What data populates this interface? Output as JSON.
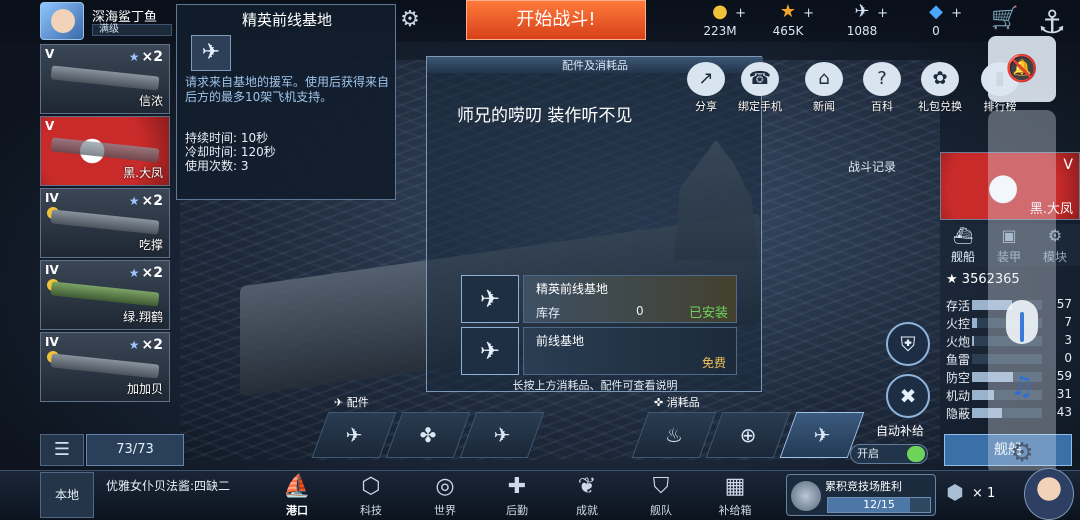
{
  "player": {
    "name": "深海鲨丁鱼",
    "level_label": "满级"
  },
  "header": {
    "start_battle": "开始战斗!"
  },
  "resources": [
    {
      "icon": "gold-coin-icon",
      "value": "223M",
      "color": "#f0c23a"
    },
    {
      "icon": "star-icon",
      "value": "465K",
      "color": "#f3a52b"
    },
    {
      "icon": "plane-icon",
      "value": "1088",
      "color": "#cfe0f0"
    },
    {
      "icon": "diamond-icon",
      "value": "0",
      "color": "#4aa6ff"
    }
  ],
  "ship_list": [
    {
      "tier": "V",
      "mult": "×2",
      "name": "信浓",
      "flag": false
    },
    {
      "tier": "V",
      "mult": "",
      "name": "黑.大凤",
      "flag": true
    },
    {
      "tier": "IV",
      "mult": "×2",
      "name": "吃撑",
      "flag": false
    },
    {
      "tier": "IV",
      "mult": "×2",
      "name": "绿.翔鹤",
      "flag": false
    },
    {
      "tier": "IV",
      "mult": "×2",
      "name": "加加贝",
      "flag": false
    }
  ],
  "list_count": "73/73",
  "tooltip": {
    "title": "精英前线基地",
    "desc": "请求来自基地的援军。使用后获得来自后方的最多10架飞机支持。",
    "duration": "持续时间: 10秒",
    "cooldown": "冷却时间: 120秒",
    "uses": "使用次数: 3"
  },
  "panel": {
    "title": "配件及消耗品",
    "message": "师兄的唠叨 装作听不见",
    "items": [
      {
        "name": "精英前线基地",
        "stock_label": "库存",
        "qty": "0",
        "status": "已安装"
      },
      {
        "name": "前线基地",
        "status": "免费"
      }
    ],
    "hint": "长按上方消耗品、配件可查看说明"
  },
  "side_icons": [
    "分享",
    "绑定手机",
    "新闻",
    "百科",
    "礼包兑换",
    "排行榜"
  ],
  "battle_record": "战斗记录",
  "ship_panel": {
    "tier": "V",
    "name": "黑.大凤",
    "tabs": [
      "舰船",
      "装甲",
      "模块"
    ],
    "power": "3562365",
    "stats": [
      {
        "label": "存活",
        "value": "57",
        "pct": 0.57
      },
      {
        "label": "火控",
        "value": "7",
        "pct": 0.07
      },
      {
        "label": "火炮",
        "value": "3",
        "pct": 0.03
      },
      {
        "label": "鱼雷",
        "value": "0",
        "pct": 0.0
      },
      {
        "label": "防空",
        "value": "59",
        "pct": 0.59
      },
      {
        "label": "机动",
        "value": "31",
        "pct": 0.31
      },
      {
        "label": "隐蔽",
        "value": "43",
        "pct": 0.43
      }
    ],
    "ship_button": "舰船"
  },
  "equipment": {
    "parts_label": "配件",
    "consumables_label": "消耗品"
  },
  "auto_supply": {
    "label": "自动补给",
    "state": "开启"
  },
  "chat": {
    "channel": "本地",
    "line": "优雅女仆贝法酱:四缺二"
  },
  "nav": [
    "港口",
    "科技",
    "世界",
    "后勤",
    "成就",
    "舰队",
    "补给箱"
  ],
  "arena": {
    "title": "累积竞技场胜利",
    "progress": "12/15",
    "ratio": 0.8
  },
  "chest": {
    "count": "× 1"
  }
}
